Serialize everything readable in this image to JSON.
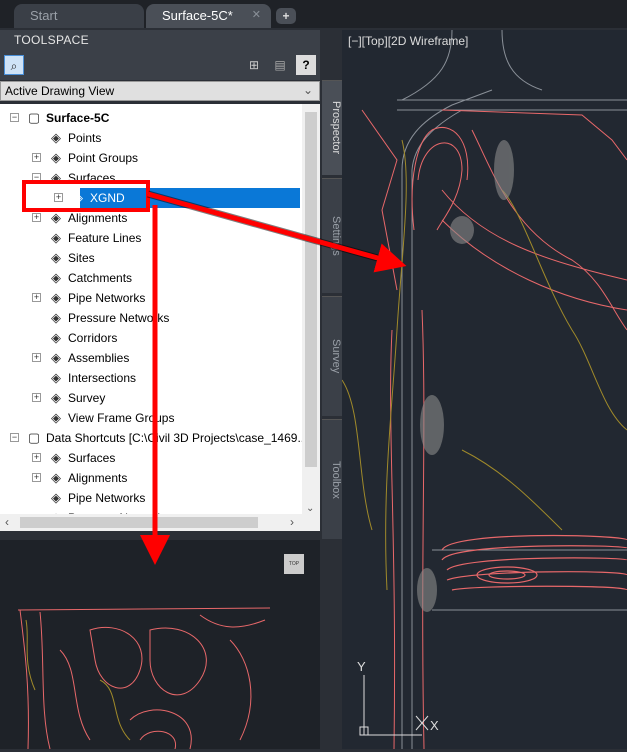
{
  "tabs": [
    {
      "label": "Start"
    },
    {
      "label": "Surface-5C*",
      "active": true
    }
  ],
  "toolspace": {
    "title": "TOOLSPACE",
    "view_select": "Active Drawing View",
    "help_label": "?",
    "tree": [
      {
        "label": "Surface-5C",
        "icon": "drawing-icon",
        "level": 0,
        "exp": "-"
      },
      {
        "label": "Points",
        "icon": "points-icon",
        "level": 1,
        "exp": ""
      },
      {
        "label": "Point Groups",
        "icon": "point-groups-icon",
        "level": 1,
        "exp": "+"
      },
      {
        "label": "Surfaces",
        "icon": "surfaces-icon",
        "level": 1,
        "exp": "-"
      },
      {
        "label": "XGND",
        "icon": "surface-icon",
        "level": 2,
        "exp": "+",
        "selected": true
      },
      {
        "label": "Alignments",
        "icon": "alignments-icon",
        "level": 1,
        "exp": "+"
      },
      {
        "label": "Feature Lines",
        "icon": "feature-lines-icon",
        "level": 1,
        "exp": ""
      },
      {
        "label": "Sites",
        "icon": "sites-icon",
        "level": 1,
        "exp": ""
      },
      {
        "label": "Catchments",
        "icon": "catchments-icon",
        "level": 1,
        "exp": ""
      },
      {
        "label": "Pipe Networks",
        "icon": "pipe-networks-icon",
        "level": 1,
        "exp": "+"
      },
      {
        "label": "Pressure Networks",
        "icon": "pressure-networks-icon",
        "level": 1,
        "exp": ""
      },
      {
        "label": "Corridors",
        "icon": "corridors-icon",
        "level": 1,
        "exp": ""
      },
      {
        "label": "Assemblies",
        "icon": "assemblies-icon",
        "level": 1,
        "exp": "+"
      },
      {
        "label": "Intersections",
        "icon": "intersections-icon",
        "level": 1,
        "exp": ""
      },
      {
        "label": "Survey",
        "icon": "survey-icon",
        "level": 1,
        "exp": "+"
      },
      {
        "label": "View Frame Groups",
        "icon": "view-frame-groups-icon",
        "level": 1,
        "exp": ""
      },
      {
        "label": "Data Shortcuts [C:\\Civil 3D Projects\\case_1469...",
        "icon": "shortcut-icon",
        "level": 0,
        "exp": "-"
      },
      {
        "label": "Surfaces",
        "icon": "surfaces-icon",
        "level": 1,
        "exp": "+"
      },
      {
        "label": "Alignments",
        "icon": "alignments-icon",
        "level": 1,
        "exp": "+"
      },
      {
        "label": "Pipe Networks",
        "icon": "pipe-networks-icon",
        "level": 1,
        "exp": ""
      },
      {
        "label": "Pressure Networks",
        "icon": "pressure-networks-icon",
        "level": 1,
        "exp": ""
      }
    ],
    "side_tabs": [
      "Prospector",
      "Settings",
      "Survey",
      "Toolbox"
    ]
  },
  "preview": {
    "top_button": "TOP"
  },
  "viewport": {
    "label": "[−][Top][2D Wireframe]",
    "ucs_y": "Y",
    "ucs_x": "X"
  },
  "colors": {
    "highlight": "#ff0000",
    "selection": "#0a78d7",
    "contour_major": "#e8686a",
    "contour_minor": "#a08a2a"
  }
}
